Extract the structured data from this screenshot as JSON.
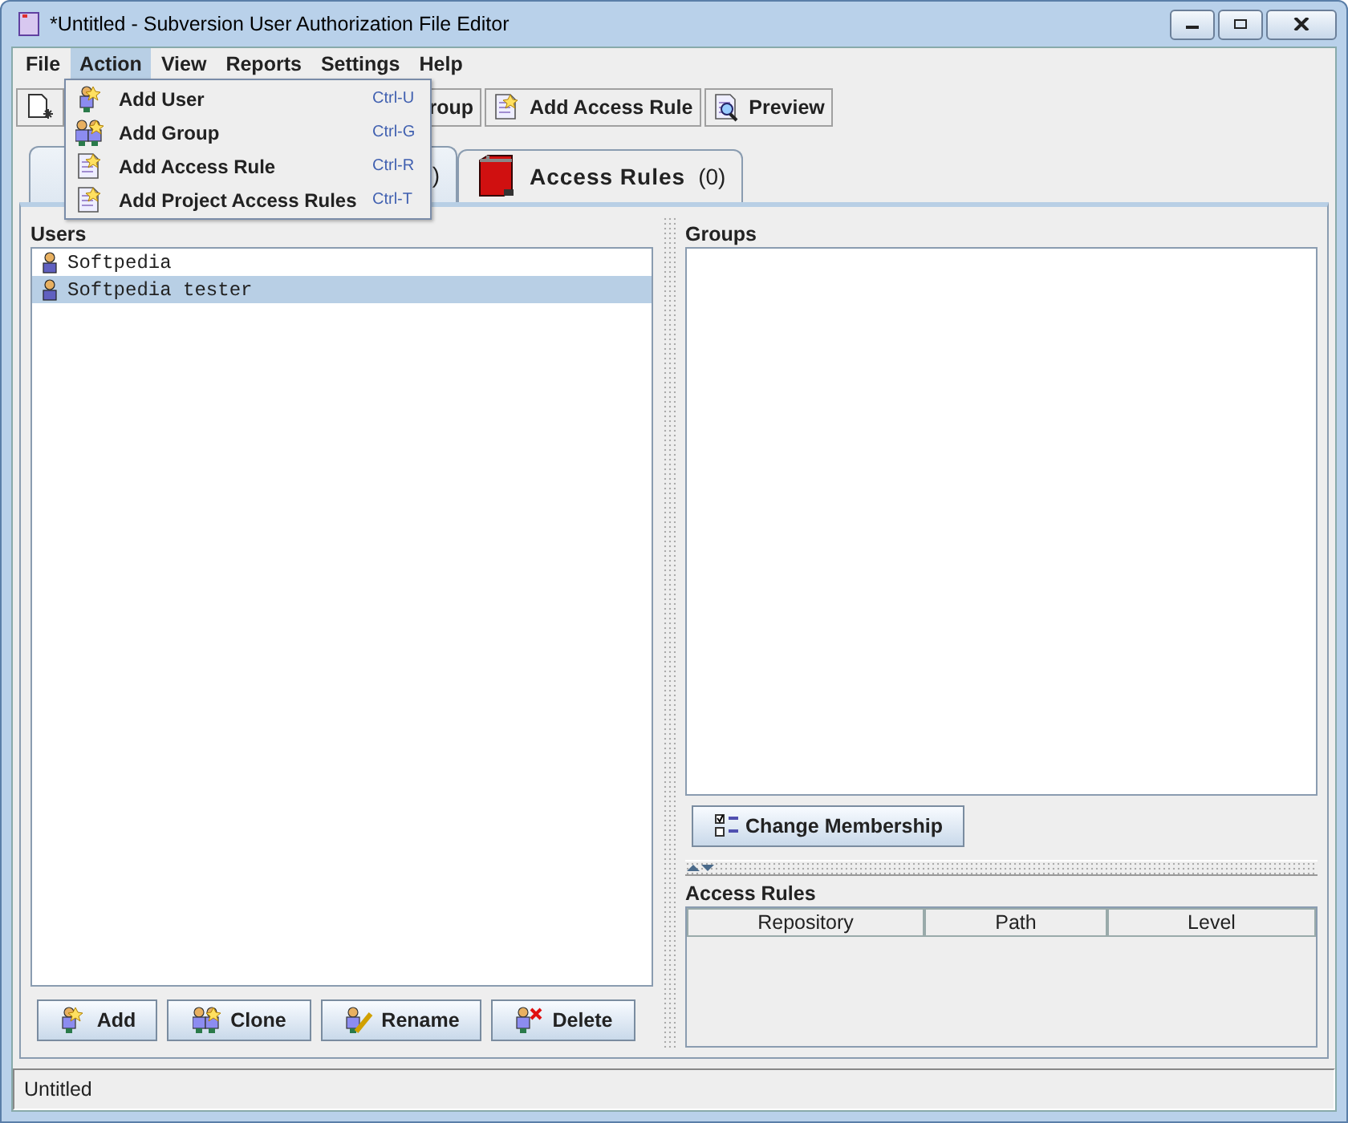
{
  "window": {
    "title": "*Untitled - Subversion User Authorization File Editor"
  },
  "menu_bar": [
    {
      "label": "File",
      "selected": false
    },
    {
      "label": "Action",
      "selected": true
    },
    {
      "label": "View",
      "selected": false
    },
    {
      "label": "Reports",
      "selected": false
    },
    {
      "label": "Settings",
      "selected": false
    },
    {
      "label": "Help",
      "selected": false
    }
  ],
  "action_menu": [
    {
      "label": "Add User",
      "shortcut": "Ctrl-U",
      "kind": "user"
    },
    {
      "label": "Add Group",
      "shortcut": "Ctrl-G",
      "kind": "group"
    },
    {
      "label": "Add Access Rule",
      "shortcut": "Ctrl-R",
      "kind": "rule"
    },
    {
      "label": "Add Project Access Rules",
      "shortcut": "Ctrl-T",
      "kind": "rule"
    }
  ],
  "toolbar": [
    {
      "kind": "new"
    },
    {
      "kind": "group",
      "label": "roup"
    },
    {
      "kind": "rule",
      "label": "Add Access Rule"
    },
    {
      "kind": "preview",
      "label": "Preview"
    }
  ],
  "tabs": [
    {
      "count": ")",
      "selected": true
    },
    {
      "label": "Access Rules",
      "count": "(0)",
      "selected": false
    }
  ],
  "users": {
    "title": "Users",
    "items": [
      {
        "name": "Softpedia",
        "selected": false
      },
      {
        "name": "Softpedia tester",
        "selected": true
      }
    ],
    "buttons": [
      {
        "label": "Add",
        "kind": "add"
      },
      {
        "label": "Clone",
        "kind": "clone"
      },
      {
        "label": "Rename",
        "kind": "rename"
      },
      {
        "label": "Delete",
        "kind": "delete"
      }
    ]
  },
  "groups": {
    "title": "Groups",
    "button": "Change Membership"
  },
  "access_rules": {
    "title": "Access Rules",
    "columns": [
      "Repository",
      "Path",
      "Level"
    ]
  },
  "status_bar": {
    "text": "Untitled"
  }
}
